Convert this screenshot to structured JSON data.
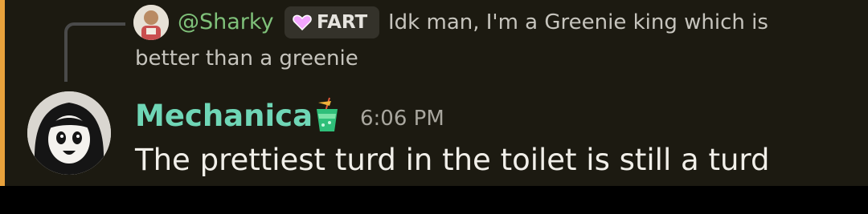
{
  "reply": {
    "author": "@Sharky",
    "tag_label": "FART",
    "text_line1": "Idk man, I'm a Greenie king which is",
    "text_line2": "better than a greenie"
  },
  "message": {
    "author": "Mechanica",
    "timestamp": "6:06 PM",
    "content": "The prettiest turd in the toilet is still a turd"
  },
  "icons": {
    "reply_avatar": "user-avatar-icon",
    "tag_icon": "heart-icon",
    "author_emoji": "tropical-drink-icon",
    "author_avatar": "user-avatar-icon"
  },
  "colors": {
    "mention_bar": "#e8a23c",
    "message_background": "#1c1a11",
    "reply_author": "#7fc17a",
    "author": "#6fd6b6",
    "tag_heart": "#f3a6ff"
  }
}
